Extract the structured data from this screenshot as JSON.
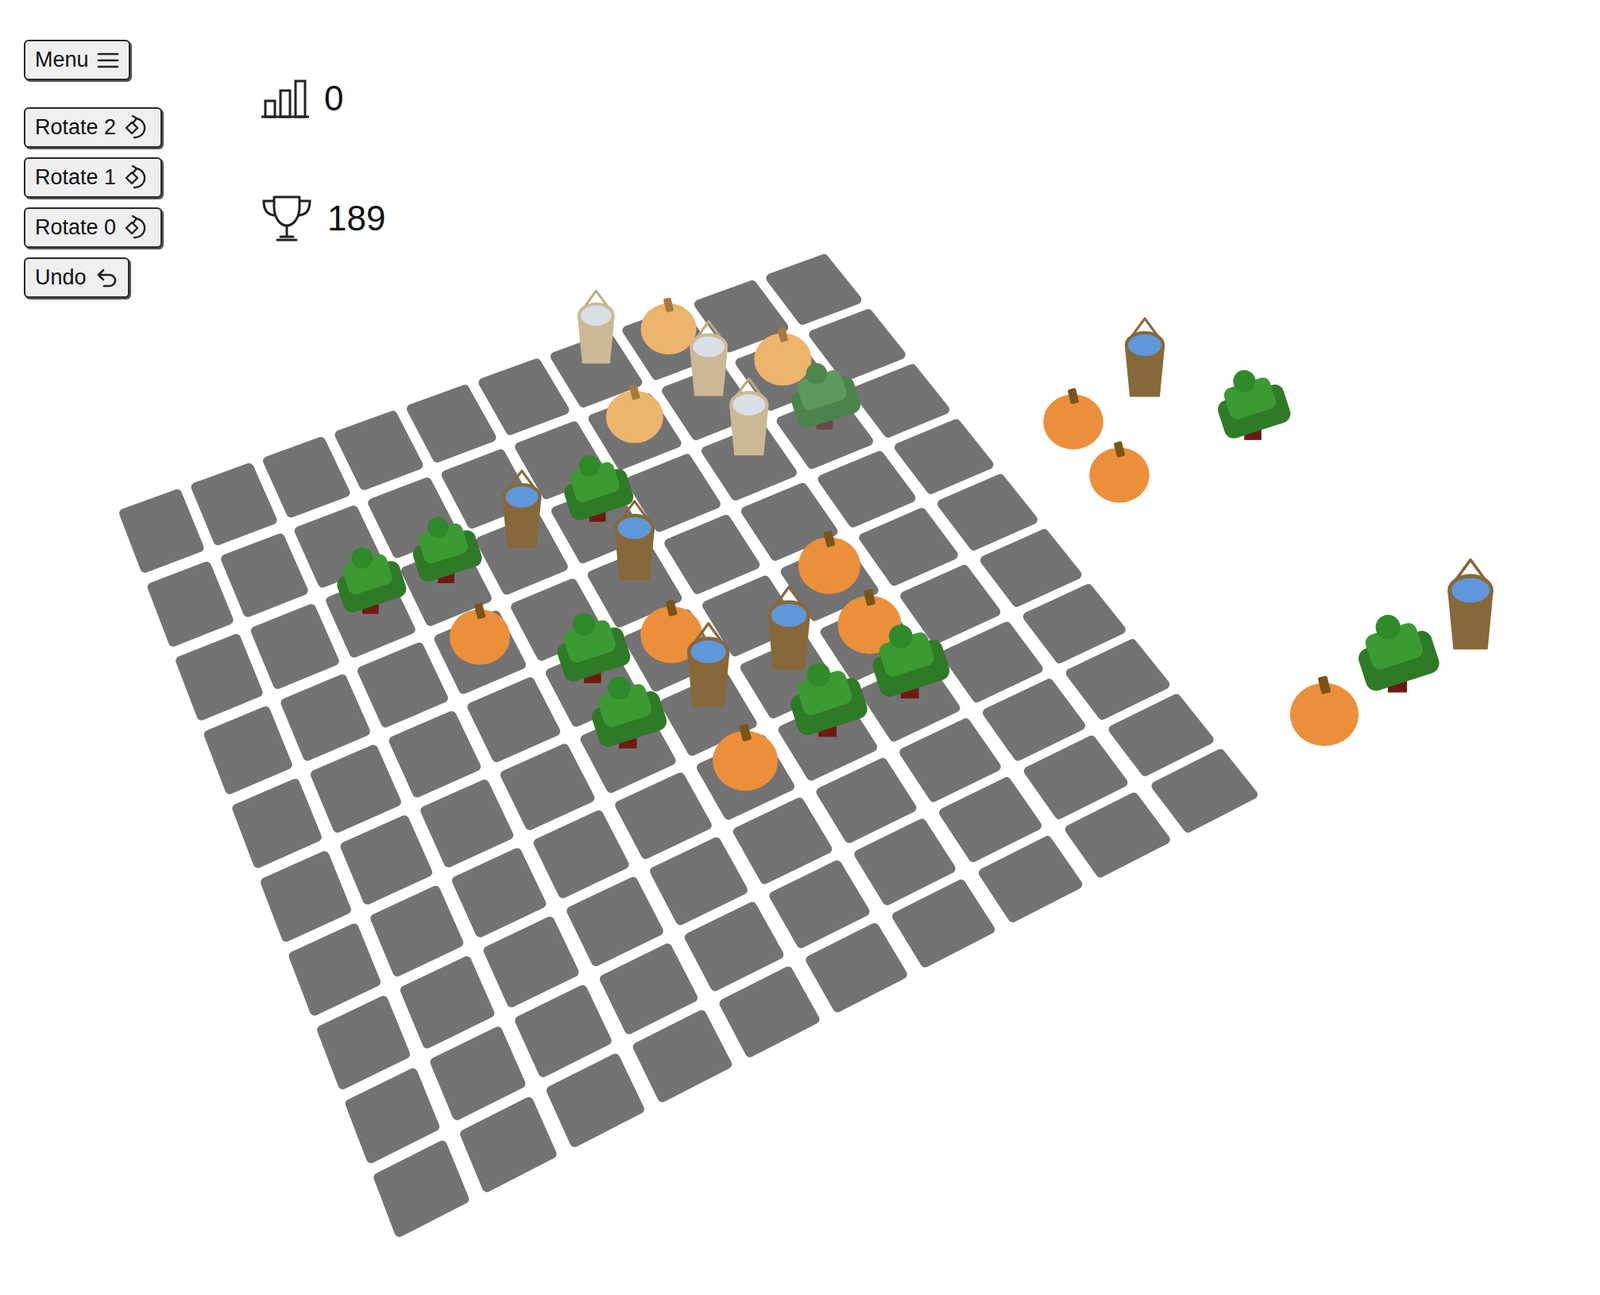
{
  "menu": {
    "label": "Menu"
  },
  "rotate_buttons": [
    {
      "label": "Rotate 2"
    },
    {
      "label": "Rotate 1"
    },
    {
      "label": "Rotate 0"
    }
  ],
  "undo": {
    "label": "Undo"
  },
  "stats": [
    {
      "kind": "level",
      "value": "0"
    },
    {
      "kind": "trophy",
      "value": "189"
    }
  ],
  "board": {
    "rows": 10,
    "columns": 10,
    "pieces": [
      {
        "kind": "bucket",
        "col": 6,
        "row": 0,
        "faded": true
      },
      {
        "kind": "pumpkin",
        "col": 7,
        "row": 0,
        "faded": true
      },
      {
        "kind": "bucket",
        "col": 7,
        "row": 1,
        "faded": true
      },
      {
        "kind": "pumpkin",
        "col": 8,
        "row": 1,
        "faded": true
      },
      {
        "kind": "pumpkin",
        "col": 6,
        "row": 1,
        "faded": true
      },
      {
        "kind": "bucket",
        "col": 7,
        "row": 2,
        "faded": true
      },
      {
        "kind": "tree",
        "col": 8,
        "row": 2,
        "faded": true
      },
      {
        "kind": "tree",
        "col": 2,
        "row": 2,
        "faded": false
      },
      {
        "kind": "tree",
        "col": 3,
        "row": 2,
        "faded": false
      },
      {
        "kind": "bucket",
        "col": 4,
        "row": 2,
        "faded": false
      },
      {
        "kind": "tree",
        "col": 5,
        "row": 2,
        "faded": false
      },
      {
        "kind": "bucket",
        "col": 5,
        "row": 3,
        "faded": false
      },
      {
        "kind": "pumpkin",
        "col": 3,
        "row": 3,
        "faded": false
      },
      {
        "kind": "tree",
        "col": 4,
        "row": 4,
        "faded": false
      },
      {
        "kind": "pumpkin",
        "col": 5,
        "row": 4,
        "faded": false
      },
      {
        "kind": "pumpkin",
        "col": 7,
        "row": 4,
        "faded": false
      },
      {
        "kind": "pumpkin",
        "col": 7,
        "row": 5,
        "faded": false
      },
      {
        "kind": "bucket",
        "col": 6,
        "row": 5,
        "faded": false
      },
      {
        "kind": "tree",
        "col": 4,
        "row": 5,
        "faded": false
      },
      {
        "kind": "bucket",
        "col": 5,
        "row": 5,
        "faded": false
      },
      {
        "kind": "pumpkin",
        "col": 5,
        "row": 6,
        "faded": false
      },
      {
        "kind": "tree",
        "col": 6,
        "row": 6,
        "faded": false
      },
      {
        "kind": "tree",
        "col": 7,
        "row": 6,
        "faded": false
      }
    ]
  },
  "tray": [
    {
      "cells": [
        {
          "kind": "pumpkin",
          "col": 0,
          "row": 0
        },
        {
          "kind": "bucket",
          "col": 1,
          "row": 0
        },
        {
          "kind": "pumpkin",
          "col": 0,
          "row": 1
        }
      ]
    },
    {
      "cells": [
        {
          "kind": "tree",
          "col": 0,
          "row": 0
        }
      ]
    },
    {
      "cells": [
        {
          "kind": "pumpkin",
          "col": 0,
          "row": 0
        },
        {
          "kind": "tree",
          "col": 1,
          "row": 0
        },
        {
          "kind": "bucket",
          "col": 2,
          "row": 0
        }
      ]
    }
  ]
}
